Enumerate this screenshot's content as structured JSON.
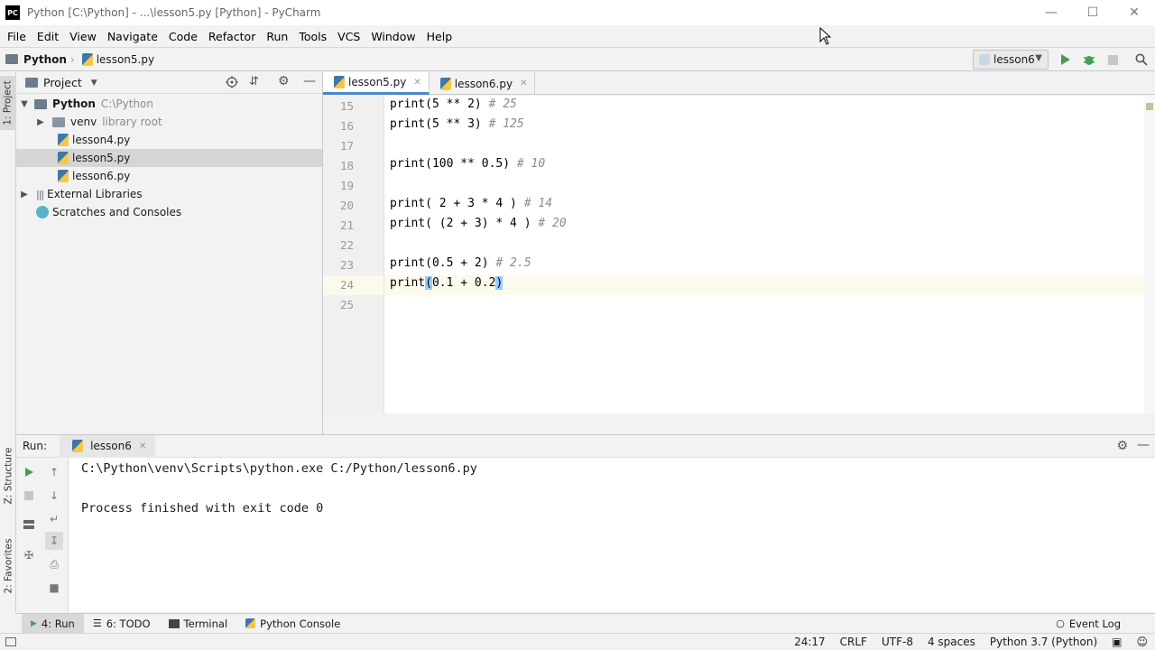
{
  "window": {
    "title": "Python [C:\\Python] - ...\\lesson5.py [Python] - PyCharm",
    "logo": "PC"
  },
  "menu": [
    "File",
    "Edit",
    "View",
    "Navigate",
    "Code",
    "Refactor",
    "Run",
    "Tools",
    "VCS",
    "Window",
    "Help"
  ],
  "breadcrumb": {
    "project": "Python",
    "file": "lesson5.py"
  },
  "run_config": {
    "name": "lesson6"
  },
  "left_strip": {
    "project_tab": "1: Project",
    "structure_tab": "Z: Structure",
    "favorites_tab": "2: Favorites"
  },
  "project_panel": {
    "title": "Project",
    "root": {
      "name": "Python",
      "path": "C:\\Python"
    },
    "venv": {
      "name": "venv",
      "tag": "library root"
    },
    "files": [
      "lesson4.py",
      "lesson5.py",
      "lesson6.py"
    ],
    "external": "External Libraries",
    "scratches": "Scratches and Consoles"
  },
  "editor": {
    "tabs": [
      "lesson5.py",
      "lesson6.py"
    ],
    "lines": [
      {
        "num": "15",
        "code": "print(5 ** 2)",
        "comment": " # 25"
      },
      {
        "num": "16",
        "code": "print(5 ** 3)",
        "comment": " # 125"
      },
      {
        "num": "17",
        "code": "",
        "comment": ""
      },
      {
        "num": "18",
        "code": "print(100 ** 0.5)",
        "comment": " # 10"
      },
      {
        "num": "19",
        "code": "",
        "comment": ""
      },
      {
        "num": "20",
        "code": "print( 2 + 3 * 4 )",
        "comment": " # 14"
      },
      {
        "num": "21",
        "code": "print( (2 + 3) * 4 )",
        "comment": " # 20"
      },
      {
        "num": "22",
        "code": "",
        "comment": ""
      },
      {
        "num": "23",
        "code": "print(0.5 + 2)",
        "comment": " # 2.5"
      },
      {
        "num": "24",
        "code_pre": "print",
        "code_open": "(",
        "code_mid": "0.1 + 0.2",
        "code_close": ")"
      },
      {
        "num": "25",
        "code": "",
        "comment": ""
      }
    ]
  },
  "run_panel": {
    "label": "Run:",
    "tab": "lesson6",
    "output": [
      "C:\\Python\\venv\\Scripts\\python.exe C:/Python/lesson6.py",
      "",
      "Process finished with exit code 0"
    ]
  },
  "tool_windows": {
    "run": "4: Run",
    "todo": "6: TODO",
    "terminal": "Terminal",
    "console": "Python Console",
    "event_log": "Event Log"
  },
  "status": {
    "position": "24:17",
    "line_sep": "CRLF",
    "encoding": "UTF-8",
    "indent": "4 spaces",
    "interpreter": "Python 3.7 (Python)"
  },
  "colors": {
    "accent": "#4a88c7",
    "run_green": "#499c54",
    "current_line": "#fcfaed"
  }
}
